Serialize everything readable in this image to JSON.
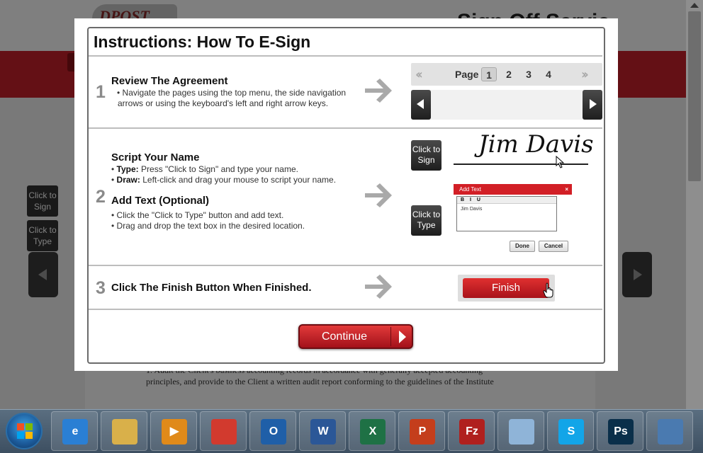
{
  "background": {
    "logo_text": "DPOST",
    "page_title": "Sign Off Servic",
    "side_buttons": [
      "Click to Sign",
      "Click to Type"
    ],
    "doc_lines": [
      "1. Audit the Client's business accounting records in accordance with generally accepted accounting",
      "principles, and provide to the Client a written audit report conforming to the guidelines of the Institute"
    ]
  },
  "modal": {
    "title": "Instructions: How To E-Sign",
    "steps": [
      {
        "number": "1",
        "heading": "Review The Agreement",
        "lines": [
          "• Navigate the pages using the top menu, the side navigation",
          "arrows or using the keyboard's left and right arrow keys."
        ]
      },
      {
        "number": "2",
        "heading": "Script Your Name",
        "type_label": "Type:",
        "type_text": "Press \"Click to Sign\" and type your name.",
        "draw_label": "Draw:",
        "draw_text": "Left-click and drag your mouse to script your name.",
        "heading2": "Add Text (Optional)",
        "lines2": [
          "• Click the \"Click to Type\" button and add text.",
          "• Drag and drop the text box in the desired location."
        ]
      },
      {
        "number": "3",
        "heading": "Click The Finish Button When Finished."
      }
    ],
    "page_nav": {
      "label": "Page",
      "pages": [
        "1",
        "2",
        "3",
        "4"
      ],
      "current": "1"
    },
    "click_to_sign": "Click to Sign",
    "click_to_type": "Click to Type",
    "signature": "Jim Davis",
    "add_text": {
      "title": "Add Text",
      "close": "×",
      "toolbar": "B I U",
      "value": "Jim Davis",
      "done": "Done",
      "cancel": "Cancel"
    },
    "finish_label": "Finish",
    "continue_label": "Continue"
  },
  "taskbar": {
    "apps": [
      {
        "name": "Internet Explorer",
        "icon": "ie-icon",
        "glyph": "e",
        "color": "#2a7fd4"
      },
      {
        "name": "Windows Explorer",
        "icon": "folder-icon",
        "glyph": "",
        "color": "#d9b04a"
      },
      {
        "name": "Media Player",
        "icon": "media-icon",
        "glyph": "▶",
        "color": "#e08a1a"
      },
      {
        "name": "Chrome",
        "icon": "chrome-icon",
        "glyph": "",
        "color": "#d23a2e"
      },
      {
        "name": "Outlook",
        "icon": "outlook-icon",
        "glyph": "O",
        "color": "#1f5fa8"
      },
      {
        "name": "Word",
        "icon": "word-icon",
        "glyph": "W",
        "color": "#2b5797"
      },
      {
        "name": "Excel",
        "icon": "excel-icon",
        "glyph": "X",
        "color": "#1e7145"
      },
      {
        "name": "PowerPoint",
        "icon": "powerpoint-icon",
        "glyph": "P",
        "color": "#c43e1c"
      },
      {
        "name": "FileZilla",
        "icon": "filezilla-icon",
        "glyph": "Fz",
        "color": "#b0201e"
      },
      {
        "name": "Notepad",
        "icon": "notepad-icon",
        "glyph": "",
        "color": "#8fb4d8"
      },
      {
        "name": "Skype",
        "icon": "skype-icon",
        "glyph": "S",
        "color": "#12a5e8"
      },
      {
        "name": "Photoshop",
        "icon": "photoshop-icon",
        "glyph": "Ps",
        "color": "#0a2f4a"
      },
      {
        "name": "Photo Viewer",
        "icon": "photo-viewer-icon",
        "glyph": "",
        "color": "#4a7ab0"
      }
    ]
  }
}
